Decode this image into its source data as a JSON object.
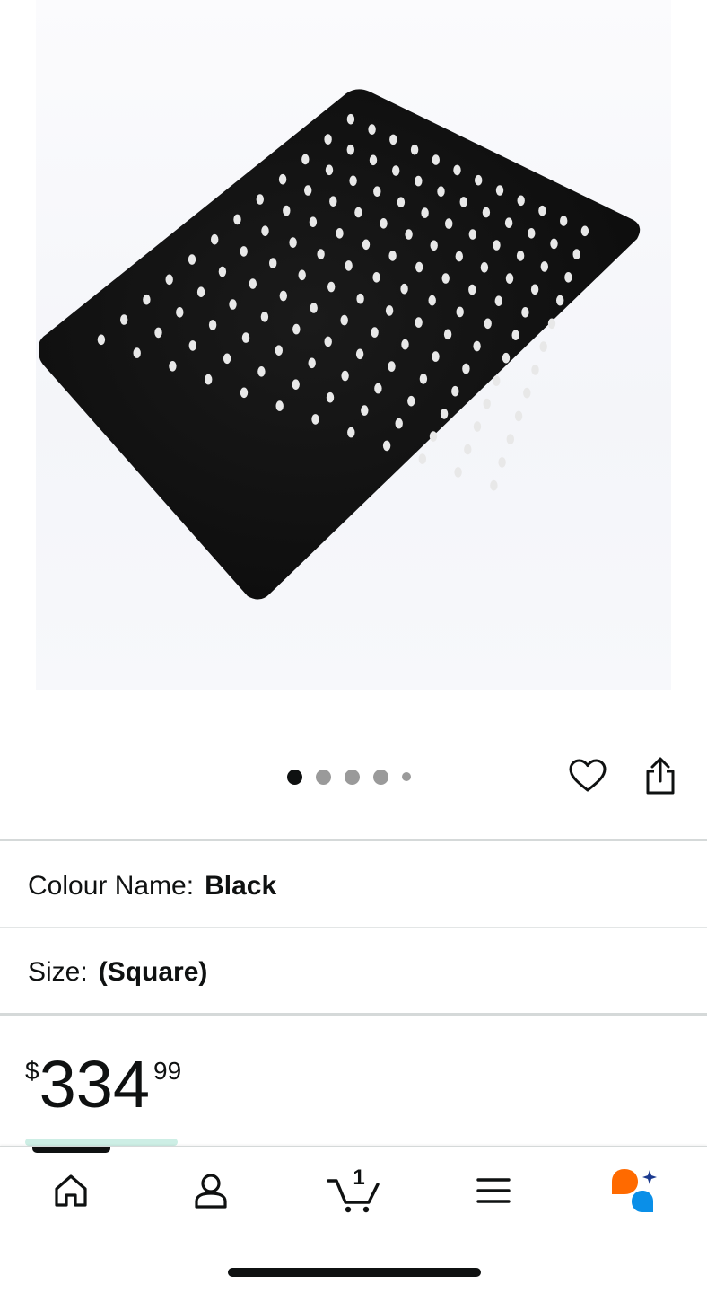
{
  "product": {
    "image_alt": "Matte black square rain shower head",
    "carousel": {
      "total_images": 5,
      "active_index": 0
    }
  },
  "actions": {
    "wishlist_icon": "heart-icon",
    "share_icon": "share-icon"
  },
  "options": {
    "colour": {
      "label": "Colour Name:",
      "value": "Black"
    },
    "size": {
      "label": "Size:",
      "value": "(Square)"
    }
  },
  "price": {
    "currency": "$",
    "whole": "334",
    "fraction": "99"
  },
  "tab_bar": {
    "active_tab": "home",
    "tabs": [
      {
        "id": "home",
        "icon": "home-icon"
      },
      {
        "id": "account",
        "icon": "user-icon"
      },
      {
        "id": "cart",
        "icon": "cart-icon",
        "count": "1"
      },
      {
        "id": "menu",
        "icon": "menu-icon"
      },
      {
        "id": "assistant",
        "icon": "assistant-icon"
      }
    ]
  },
  "colors": {
    "text": "#0f1111",
    "accent_orange": "#ff6a00",
    "accent_blue": "#0a8fe8"
  }
}
